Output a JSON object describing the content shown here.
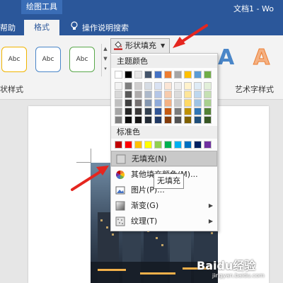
{
  "window": {
    "context_tab": "绘图工具",
    "doc_title": "文档1 - Wo"
  },
  "tabs": {
    "help": "帮助",
    "format": "格式",
    "tell_me": "操作说明搜索"
  },
  "ribbon": {
    "style_sample_text": "Abc",
    "shape_fill_label": "形状填充",
    "shape_styles_group": "状样式",
    "wordart_styles_group": "艺术字样式",
    "wordart_sample": "A",
    "colors": {
      "accent": "#2b579a",
      "style1_border": "#f0b400",
      "style2_border": "#4a86c8",
      "style3_border": "#5aa84b"
    }
  },
  "fill_menu": {
    "theme_colors_header": "主题颜色",
    "standard_colors_header": "标准色",
    "theme_colors_top": [
      "#ffffff",
      "#000000",
      "#e7e6e6",
      "#44546a",
      "#4472c4",
      "#ed7d31",
      "#a5a5a5",
      "#ffc000",
      "#5b9bd5",
      "#70ad47"
    ],
    "theme_colors_shades": [
      [
        "#f2f2f2",
        "#7f7f7f",
        "#d0cece",
        "#d6dce4",
        "#d9e2f3",
        "#fbe5d5",
        "#ededed",
        "#fff2cc",
        "#deebf6",
        "#e2efd9"
      ],
      [
        "#d8d8d8",
        "#595959",
        "#aeabab",
        "#adb9ca",
        "#b4c6e7",
        "#f7cbac",
        "#dbdbdb",
        "#fee599",
        "#bdd7ee",
        "#c5e0b3"
      ],
      [
        "#bfbfbf",
        "#3f3f3f",
        "#757070",
        "#8496b0",
        "#8eaadb",
        "#f4b183",
        "#c9c9c9",
        "#ffd965",
        "#9cc3e5",
        "#a8d08d"
      ],
      [
        "#a5a5a5",
        "#262626",
        "#3a3838",
        "#323f4f",
        "#2f5496",
        "#c55a11",
        "#7b7b7b",
        "#bf9000",
        "#2e75b5",
        "#538135"
      ],
      [
        "#7f7f7f",
        "#0c0c0c",
        "#171616",
        "#222a35",
        "#1f3864",
        "#833c0b",
        "#525252",
        "#7f6000",
        "#1e4e79",
        "#375623"
      ]
    ],
    "standard_colors": [
      "#c00000",
      "#ff0000",
      "#ffc000",
      "#ffff00",
      "#92d050",
      "#00b050",
      "#00b0f0",
      "#0070c0",
      "#002060",
      "#7030a0"
    ],
    "items": {
      "no_fill": "无填充(N)",
      "more_colors": "其他填充颜色(M)...",
      "picture": "图片(P)...",
      "gradient": "渐变(G)",
      "texture": "纹理(T)"
    }
  },
  "tooltip": "无填充",
  "watermark": {
    "brand": "Baidu经验",
    "url": "jingyan.baidu.com"
  }
}
